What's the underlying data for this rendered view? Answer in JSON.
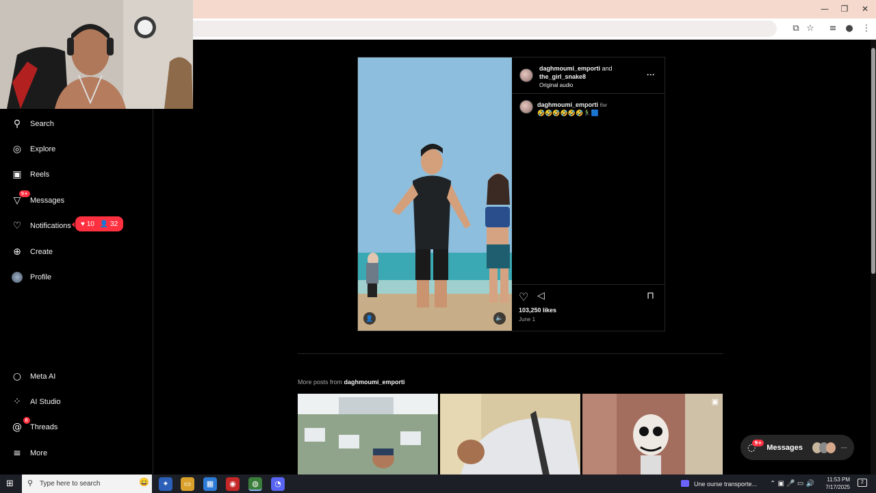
{
  "sidebar": {
    "items": [
      {
        "label": "Search",
        "icon": "search-icon"
      },
      {
        "label": "Explore",
        "icon": "compass-icon"
      },
      {
        "label": "Reels",
        "icon": "reels-icon"
      },
      {
        "label": "Messages",
        "icon": "messenger-icon",
        "badge": "9+"
      },
      {
        "label": "Notifications",
        "icon": "heart-icon"
      },
      {
        "label": "Create",
        "icon": "plus-square-icon"
      },
      {
        "label": "Profile",
        "icon": "avatar-icon"
      }
    ],
    "bottom_items": [
      {
        "label": "Meta AI",
        "icon": "meta-ai-icon"
      },
      {
        "label": "AI Studio",
        "icon": "ai-studio-icon"
      },
      {
        "label": "Threads",
        "icon": "threads-icon",
        "badge": "6"
      },
      {
        "label": "More",
        "icon": "menu-icon"
      }
    ],
    "notif_pill": {
      "likes": "10",
      "follows": "32"
    }
  },
  "post": {
    "author": "daghmoumi_emporti",
    "connector": "and",
    "coauthor": "the_girl_snake8",
    "audio": "Original audio",
    "caption_user": "daghmoumi_emporti",
    "caption_age": "6w",
    "caption_text": "🤣🤣🤣🤣🤣🤣🏃‍♂️🟦",
    "likes": "103,250 likes",
    "date": "June 1"
  },
  "more_posts": {
    "prefix": "More posts from",
    "user": "daghmoumi_emporti"
  },
  "messages_float": {
    "label": "Messages",
    "badge": "9+"
  },
  "taskbar": {
    "search_placeholder": "Type here to search",
    "news": "Une ourse transporte...",
    "time": "11:53 PM",
    "date": "7/17/2025",
    "notif_count": "2"
  },
  "colors": {
    "accent_red": "#ff3040",
    "dark_bg": "#000000",
    "border": "#262626"
  }
}
